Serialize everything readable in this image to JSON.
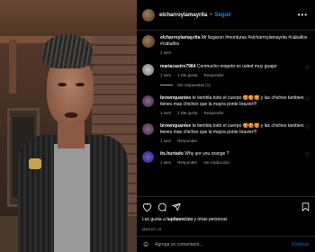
{
  "post": {
    "username": "elcharroylamayrita",
    "follow_label": "Seguir",
    "caption": "Mr llegaron #monturas #elcharroylamayrita #caballos #caballos",
    "caption_time": "1 sem"
  },
  "comments": [
    {
      "username": "mariacastro7984",
      "text": "Conmucho respeto es usted muy guapo",
      "time": "1 sem",
      "likes": "1 Me gusta",
      "reply_label": "Responder",
      "view_replies": "Ver respuestas (1)"
    },
    {
      "username": "brownquantee",
      "text": "te tiembla todo el cuerpo 🥰🥰🥰 y las chiches tambien tienes mas chiches que la mayra ponte brazier!!!",
      "time": "1 sem",
      "likes": "1 Me gusta",
      "reply_label": "Responder"
    },
    {
      "username": "brownquantee",
      "text": "te tiembla todo el cuerpo 🥰🥰🥰 y las chiches tambien tienes mas chiches que la mayra ponte brazier!!!",
      "time": "1 sem",
      "reply_label": "Responder"
    },
    {
      "username": "its.hurtado",
      "text": "Why are you orange ?",
      "time": "1 sem",
      "reply_label": "Responder",
      "translation": "Ver traducción"
    }
  ],
  "likes_line": {
    "prefix": "Les gusta a ",
    "user": "lupitaencizo",
    "suffix": " y otras personas"
  },
  "date": "MARZO 15",
  "add_comment": {
    "placeholder": "Agrega un comentario...",
    "publish_label": "Publicar"
  },
  "icons": [
    "heart-icon",
    "comment-icon",
    "share-icon",
    "save-icon",
    "smile-icon",
    "more-icon"
  ],
  "colors": {
    "accent": "#0095f6",
    "muted": "#a8a8a8",
    "background": "#000000"
  }
}
